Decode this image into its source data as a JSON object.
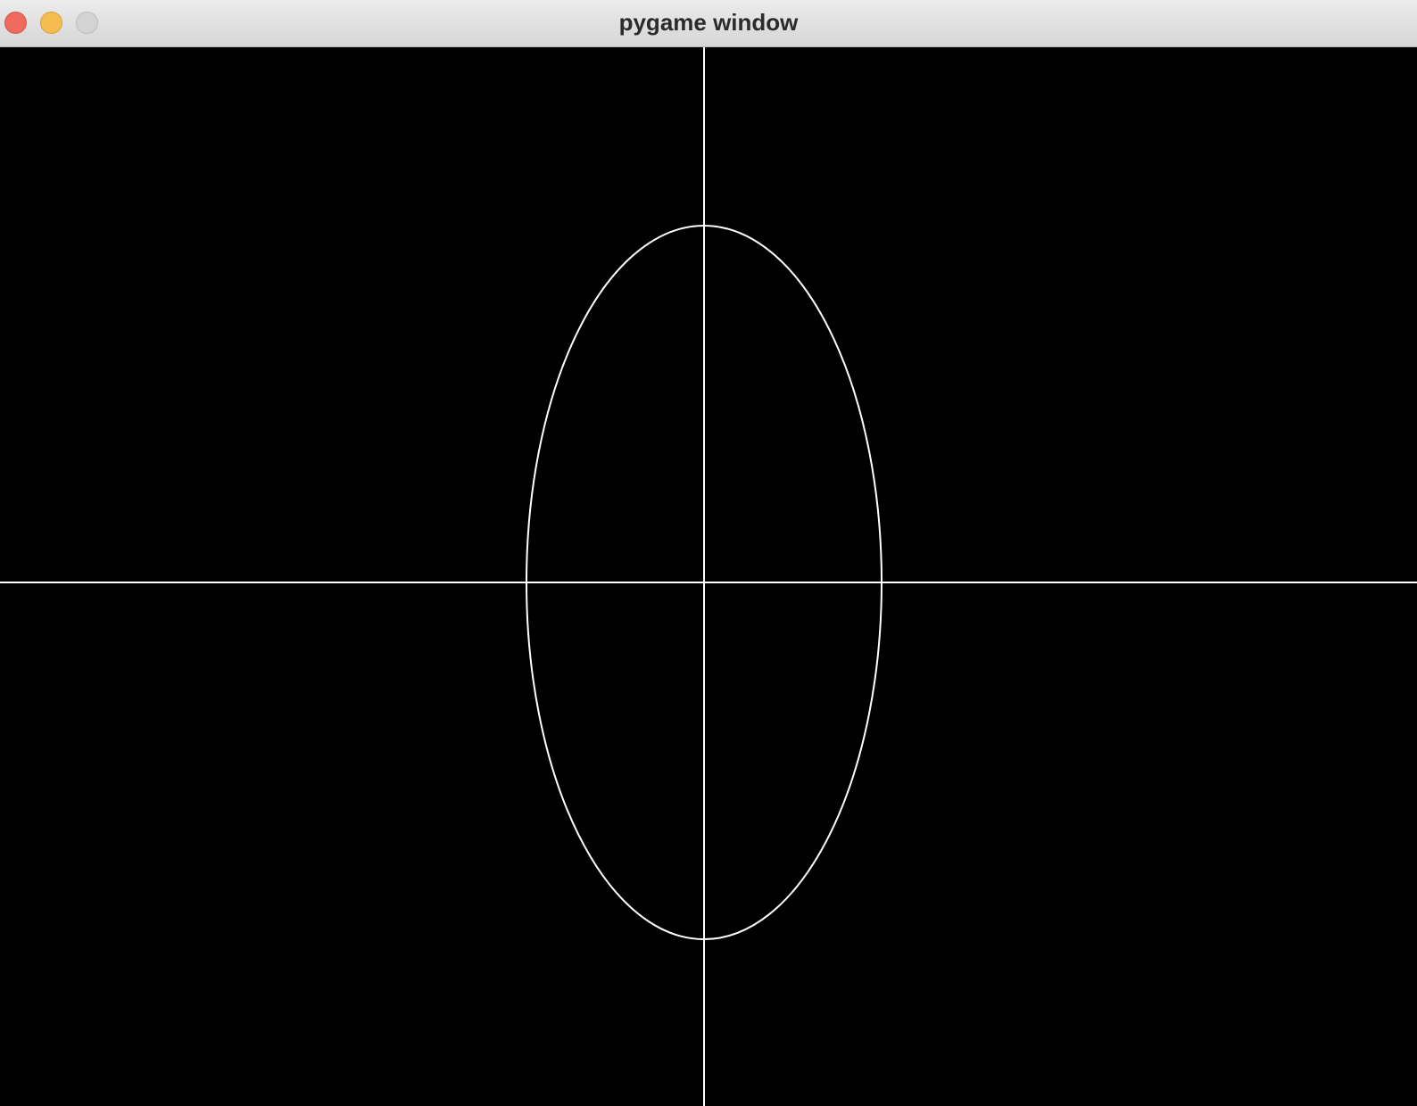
{
  "window": {
    "title": "pygame window"
  },
  "canvas": {
    "background": "#000000",
    "stroke_color": "#ffffff",
    "shapes": [
      "vertical-axis-line",
      "horizontal-axis-line",
      "ellipse"
    ]
  },
  "controls": {
    "close_color": "#ee6a5e",
    "minimize_color": "#f5bd4f",
    "zoom_color": "#d4d4d4"
  }
}
